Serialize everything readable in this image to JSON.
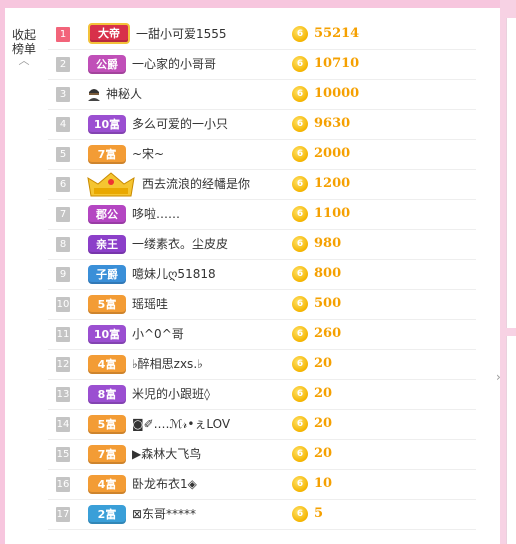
{
  "collapse": {
    "line1": "收起",
    "line2": "榜单"
  },
  "colors": {
    "accent": "#f7c6de",
    "score": "#f5a000",
    "rank_top": "#f2647a"
  },
  "rows": [
    {
      "rank": "1",
      "badge": "大帝",
      "badge_color": "#d8304a",
      "badge_type": "king",
      "name": "一甜小可爱1555",
      "score": "55214"
    },
    {
      "rank": "2",
      "badge": "公爵",
      "badge_color": "#c04fb8",
      "badge_type": "label",
      "name": "一心家的小哥哥",
      "score": "10710"
    },
    {
      "rank": "3",
      "badge": "",
      "badge_color": "",
      "badge_type": "mystery",
      "name": "神秘人",
      "score": "10000"
    },
    {
      "rank": "4",
      "badge": "10富",
      "badge_color": "#9b4fd1",
      "badge_type": "label",
      "name": "多么可爱的一小只",
      "score": "9630"
    },
    {
      "rank": "5",
      "badge": "7富",
      "badge_color": "#f39c35",
      "badge_type": "label",
      "name": "~宋~",
      "score": "2000"
    },
    {
      "rank": "6",
      "badge": "",
      "badge_color": "#f5c531",
      "badge_type": "crown",
      "name": "西去流浪的经幡是你",
      "score": "1200"
    },
    {
      "rank": "7",
      "badge": "郡公",
      "badge_color": "#b446c2",
      "badge_type": "label",
      "name": "哆啦……",
      "score": "1100"
    },
    {
      "rank": "8",
      "badge": "亲王",
      "badge_color": "#8c3fc9",
      "badge_type": "label",
      "name": "一缕素衣。尘皮皮",
      "score": "980"
    },
    {
      "rank": "9",
      "badge": "子爵",
      "badge_color": "#3a8fd8",
      "badge_type": "label",
      "name": "噫妹儿ღ51818",
      "score": "800"
    },
    {
      "rank": "10",
      "badge": "5富",
      "badge_color": "#f39c35",
      "badge_type": "label",
      "name": "瑶瑶哇",
      "score": "500"
    },
    {
      "rank": "11",
      "badge": "10富",
      "badge_color": "#9b4fd1",
      "badge_type": "label",
      "name": "小^0^哥",
      "score": "260"
    },
    {
      "rank": "12",
      "badge": "4富",
      "badge_color": "#f39c35",
      "badge_type": "label",
      "name": "♭醉相思zxs.♭",
      "score": "20"
    },
    {
      "rank": "13",
      "badge": "8富",
      "badge_color": "#9b4fd1",
      "badge_type": "label",
      "name": "米児的小跟班◊",
      "score": "20"
    },
    {
      "rank": "14",
      "badge": "5富",
      "badge_color": "#f39c35",
      "badge_type": "label",
      "name": "◙✐.…ℳ𝓇•ぇLOV",
      "score": "20"
    },
    {
      "rank": "15",
      "badge": "7富",
      "badge_color": "#f39c35",
      "badge_type": "label",
      "name": "▶森林大飞鸟",
      "score": "20"
    },
    {
      "rank": "16",
      "badge": "4富",
      "badge_color": "#f39c35",
      "badge_type": "label",
      "name": "卧龙布衣1◈",
      "score": "10"
    },
    {
      "rank": "17",
      "badge": "2富",
      "badge_color": "#3a9fd8",
      "badge_type": "label",
      "name": "⊠东哥*****",
      "score": "5"
    }
  ]
}
